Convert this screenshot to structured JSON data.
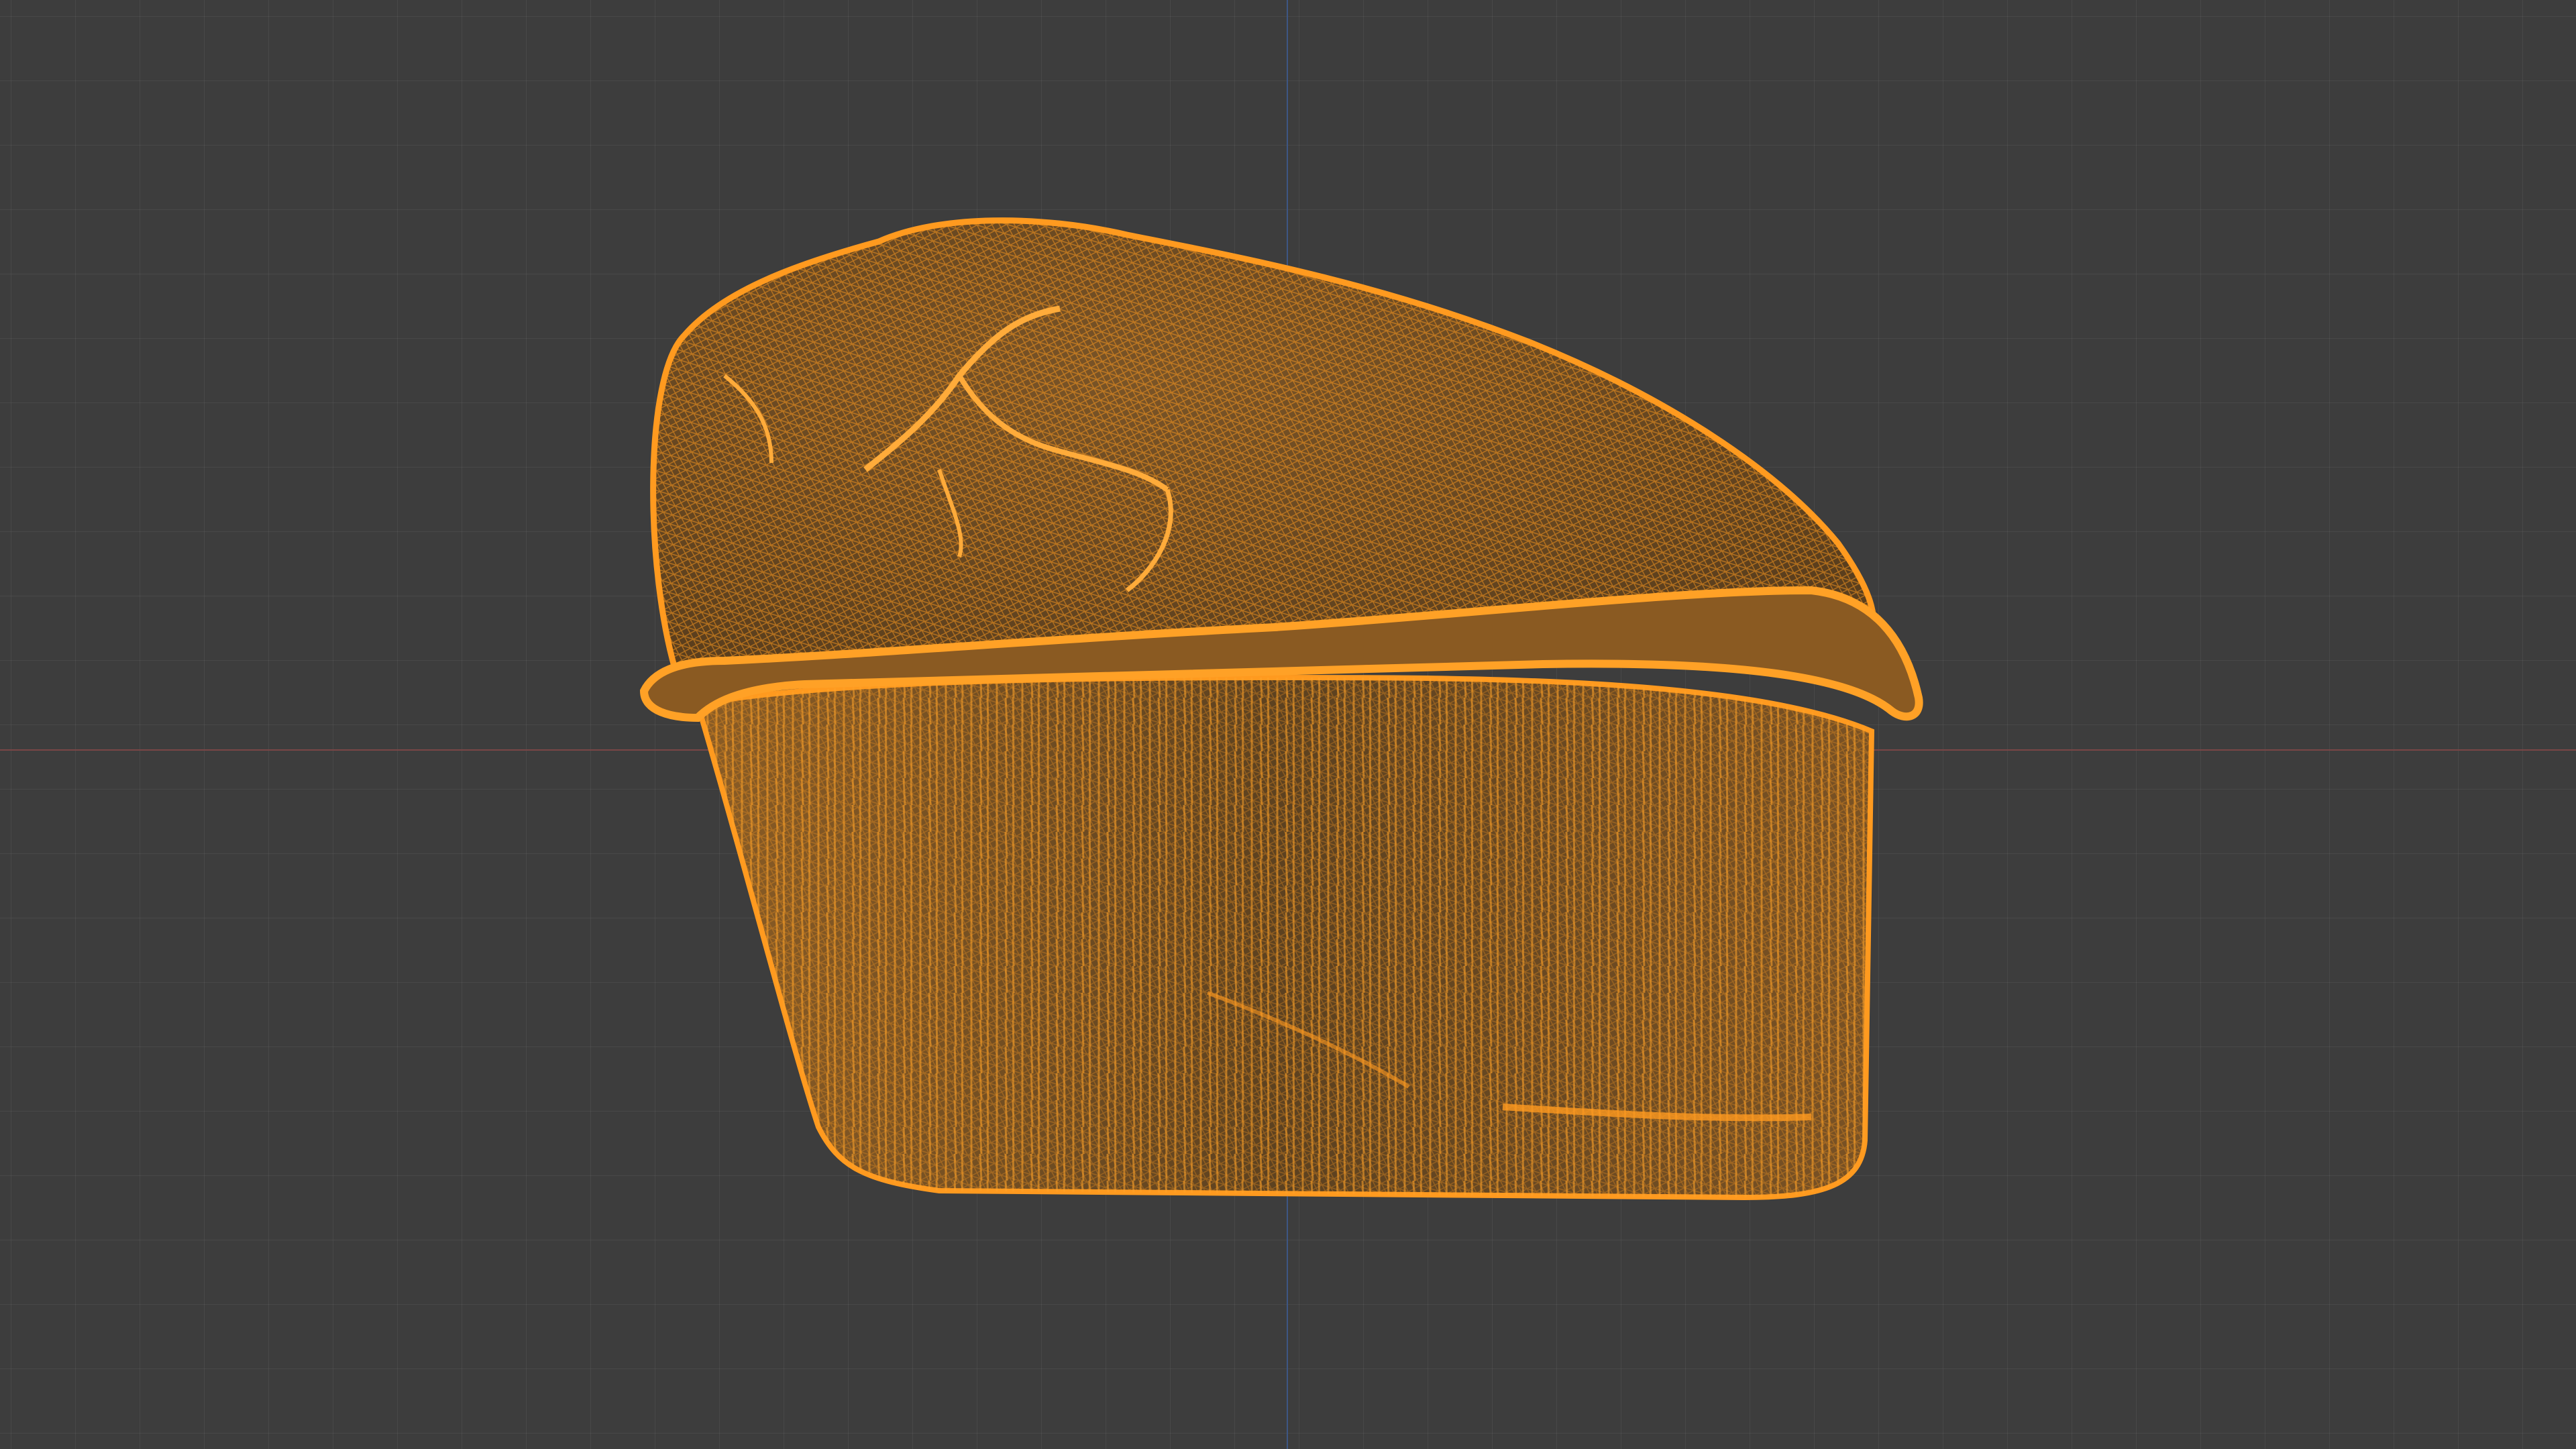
{
  "viewport": {
    "background_color": "#3d3d3d",
    "grid_line_color": "#4a4a4a",
    "x_axis_color": "#8a4a4a",
    "y_axis_color": "#3f5a8a",
    "display_mode": "wireframe"
  },
  "object": {
    "name_hint": "muffin-mesh",
    "wire_color": "#ff9a1f",
    "fill_color": "#6b4a22"
  }
}
